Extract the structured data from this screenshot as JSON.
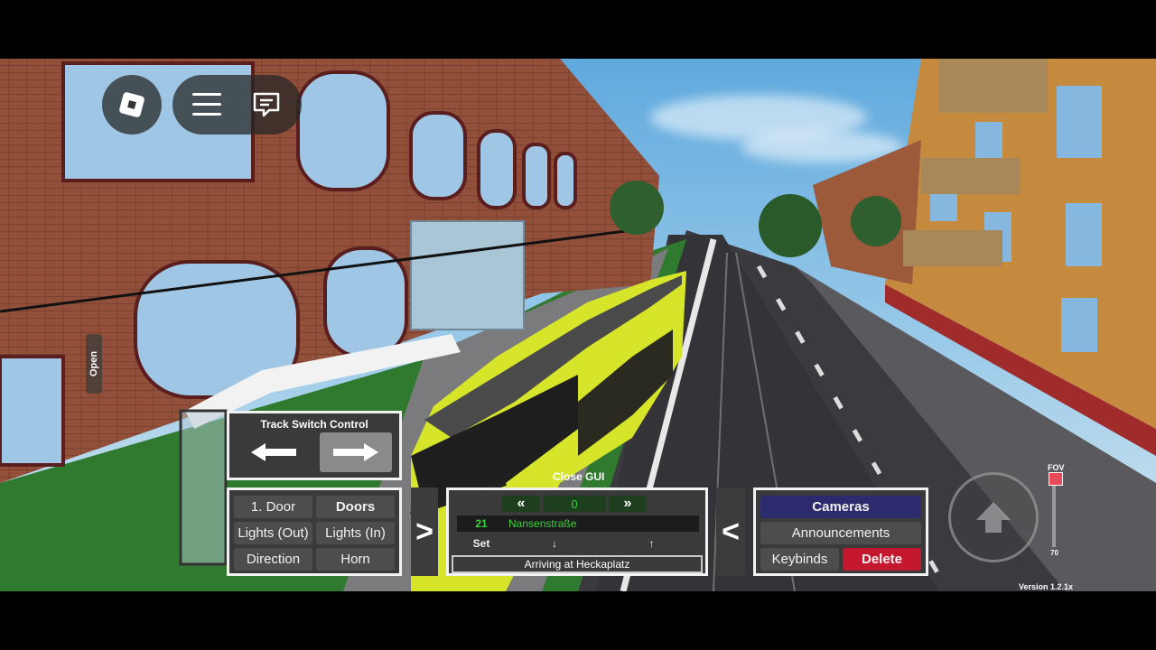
{
  "roblox": {
    "menu_icon": "hamburger-icon",
    "chat_icon": "chat-icon",
    "logo_icon": "roblox-logo-icon"
  },
  "side_tab": {
    "label": "Open"
  },
  "track_switch": {
    "title": "Track Switch Control",
    "left_icon": "arrow-left-icon",
    "right_icon": "arrow-right-icon"
  },
  "close_gui": "Close GUI",
  "controls": {
    "door": "1. Door",
    "doors": "Doors",
    "lights_out": "Lights (Out)",
    "lights_in": "Lights (In)",
    "direction": "Direction",
    "horn": "Horn"
  },
  "expand_left": ">",
  "expand_right": "<",
  "destination": {
    "prev": "«",
    "value": "0",
    "next": "»",
    "line": "21",
    "stop": "Nansenstraße",
    "set": "Set",
    "down": "↓",
    "up": "↑",
    "status": "Arriving at Heckaplatz"
  },
  "menu": {
    "cameras": "Cameras",
    "announcements": "Announcements",
    "keybinds": "Keybinds",
    "delete": "Delete"
  },
  "fov": {
    "label": "FOV",
    "value": "70"
  },
  "version": "Version 1.2.1x",
  "colors": {
    "tram": "#d6e52a",
    "accent_green": "#3ad23a",
    "cameras_bg": "#2b2b6e",
    "delete_bg": "#c4182f"
  }
}
